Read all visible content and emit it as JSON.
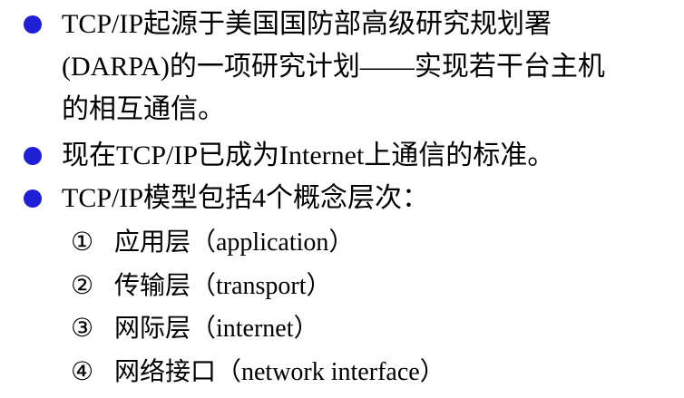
{
  "colors": {
    "bullet": "#1f1fd6",
    "text": "#000000"
  },
  "bullets": [
    {
      "lines": [
        "TCP/IP起源于美国国防部高级研究规划署",
        "(DARPA)的一项研究计划——实现若干台主机",
        "的相互通信。"
      ]
    },
    {
      "lines": [
        "现在TCP/IP已成为Internet上通信的标准。"
      ]
    },
    {
      "lines": [
        "TCP/IP模型包括4个概念层次："
      ],
      "sub_items": [
        {
          "num": "①",
          "text": "应用层（application）"
        },
        {
          "num": "②",
          "text": "传输层（transport）"
        },
        {
          "num": "③",
          "text": "网际层（internet）"
        },
        {
          "num": "④",
          "text": "网络接口（network interface）"
        }
      ]
    }
  ]
}
